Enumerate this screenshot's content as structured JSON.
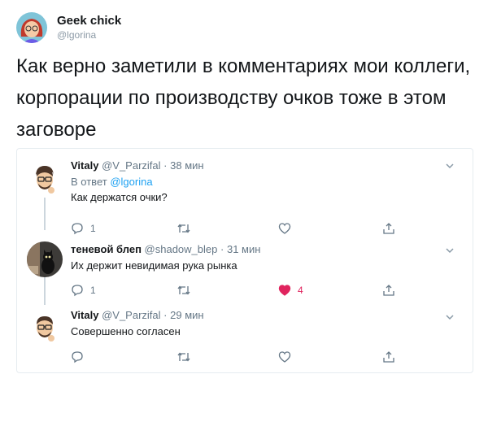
{
  "tweet": {
    "author_name": "Geek chick",
    "author_handle": "@lgorina",
    "text": "Как верно заметили в комментариях мои коллеги, корпорации по производству очков тоже в этом заговоре"
  },
  "replies": [
    {
      "name": "Vitaly",
      "handle": "@V_Parzifal",
      "sep": "·",
      "time": "38 мин",
      "in_reply_prefix": "В ответ",
      "in_reply_handle": "@lgorina",
      "text": "Как держатся очки?",
      "reply_count": "1",
      "retweet_count": "",
      "like_count": "",
      "liked": false
    },
    {
      "name": "теневой блеп",
      "handle": "@shadow_blep",
      "sep": "·",
      "time": "31 мин",
      "text": "Их держит невидимая рука рынка",
      "reply_count": "1",
      "retweet_count": "",
      "like_count": "4",
      "liked": true
    },
    {
      "name": "Vitaly",
      "handle": "@V_Parzifal",
      "sep": "·",
      "time": "29 мин",
      "text": "Совершенно согласен",
      "reply_count": "",
      "retweet_count": "",
      "like_count": "",
      "liked": false
    }
  ],
  "icons": {
    "reply": "speech-bubble-icon",
    "retweet": "retweet-icon",
    "like": "heart-icon",
    "share": "share-icon",
    "more": "chevron-down-icon"
  },
  "colors": {
    "text": "#14171a",
    "muted": "#657786",
    "link": "#1da1f2",
    "like": "#e0245e",
    "border": "#e6ecf0"
  }
}
